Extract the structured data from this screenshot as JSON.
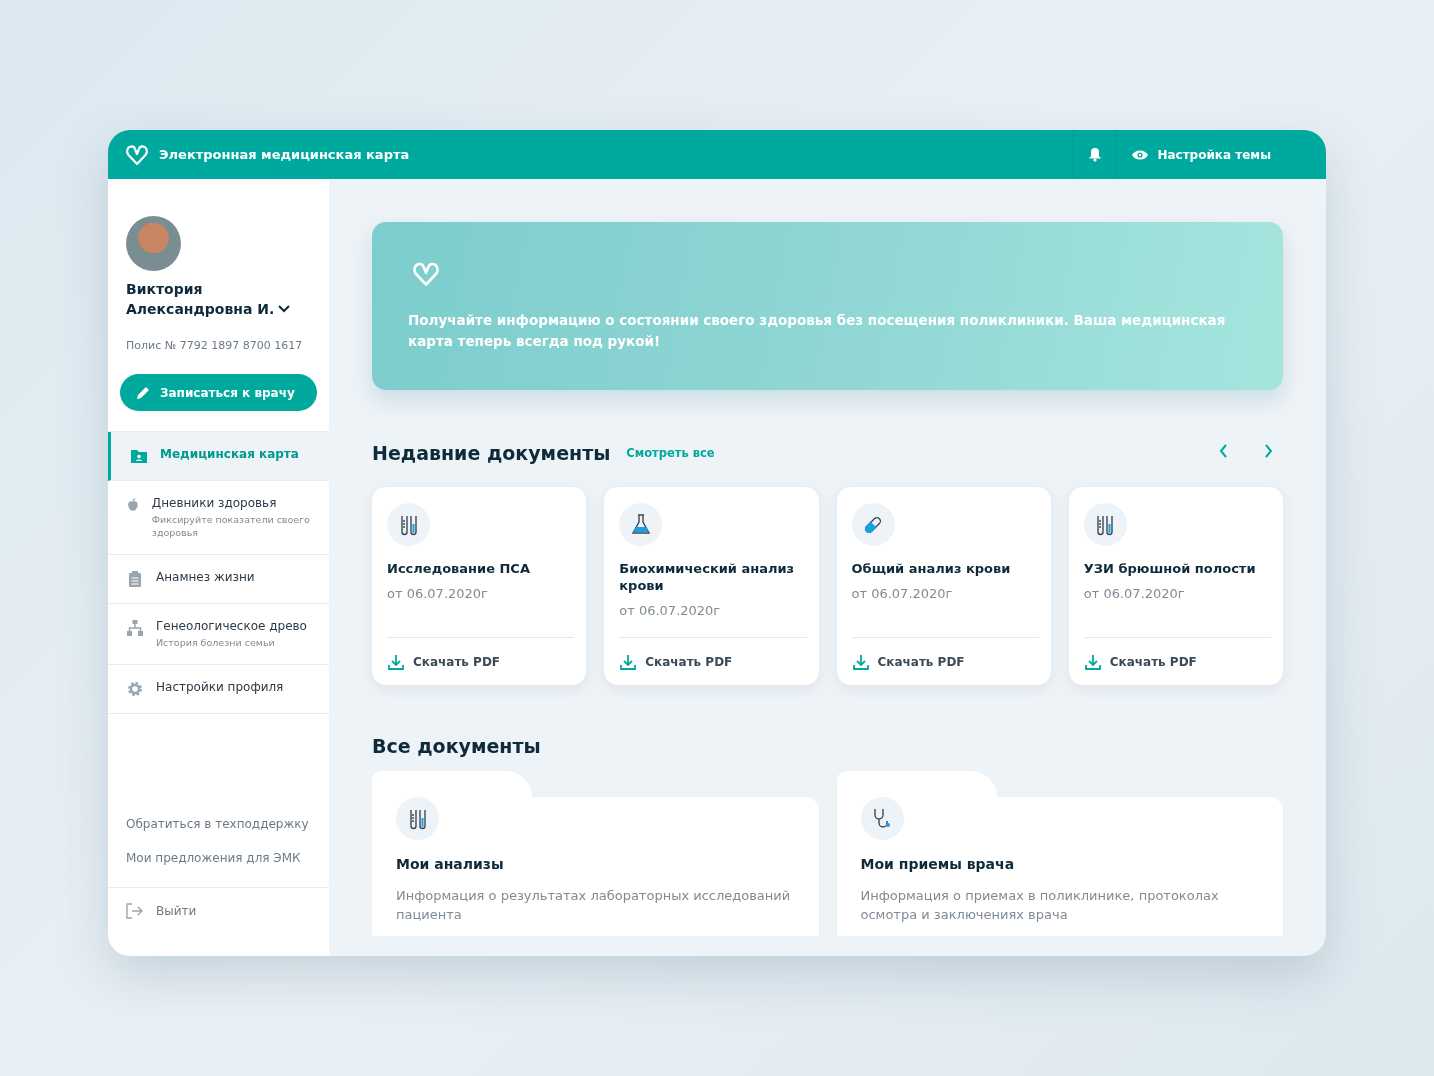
{
  "header": {
    "title": "Электронная медицинская карта",
    "theme_button": "Настройка темы"
  },
  "profile": {
    "first_name": "Виктория",
    "last_name": "Александровна И.",
    "policy": "Полис № 7792 1897 8700 1617",
    "book_button": "Записаться к врачу"
  },
  "nav": [
    {
      "label": "Медицинская карта",
      "selected": true,
      "kind": "folder"
    },
    {
      "label": "Дневники здоровья",
      "subtitle": "Фиксируйте показатели своего здоровья",
      "selected": false,
      "kind": "apple"
    },
    {
      "label": "Анамнез жизни",
      "selected": false,
      "kind": "clipboard"
    },
    {
      "label": "Генеологическое древо",
      "subtitle": "История болезни семьи",
      "selected": false,
      "kind": "tree"
    },
    {
      "label": "Настройки профиля",
      "selected": false,
      "kind": "gear"
    }
  ],
  "support_links": [
    "Обратиться в техподдержку",
    "Мои предложения для ЭМК"
  ],
  "logout": "Выйти",
  "banner": {
    "text": "Получайте информацию о состоянии своего здоровья без посещения поликлиники. Ваша медицинская карта теперь всегда под рукой!"
  },
  "recent": {
    "title": "Недавние документы",
    "see_all": "Смотреть все",
    "cards": [
      {
        "kind": "tubes",
        "title": "Исследование ПСА",
        "date": "от 06.07.2020г",
        "download": "Скачать PDF"
      },
      {
        "kind": "flask",
        "title": "Биохимический анализ крови",
        "date": "от 06.07.2020г",
        "download": "Скачать PDF"
      },
      {
        "kind": "pill",
        "title": "Общий анализ крови",
        "date": "от 06.07.2020г",
        "download": "Скачать PDF"
      },
      {
        "kind": "tubes",
        "title": "УЗИ брюшной полости",
        "date": "от 06.07.2020г",
        "download": "Скачать PDF"
      }
    ]
  },
  "all": {
    "title": "Все документы",
    "folders": [
      {
        "kind": "tubes",
        "title": "Мои анализы",
        "text": "Информация о результатах лабораторных исследований пациента"
      },
      {
        "kind": "stethoscope",
        "title": "Мои приемы врача",
        "text": "Информация о приемах в поликлинике, протоколах осмотра и заключениях врача"
      }
    ]
  }
}
